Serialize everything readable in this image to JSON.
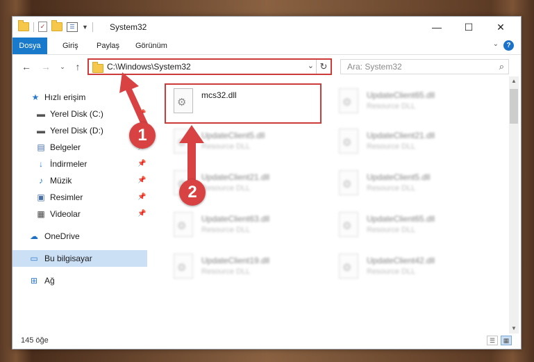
{
  "window": {
    "title": "System32",
    "controls": {
      "minimize": "—",
      "maximize": "☐",
      "close": "✕"
    }
  },
  "menu": {
    "items": [
      "Dosya",
      "Giriş",
      "Paylaş",
      "Görünüm"
    ]
  },
  "address": {
    "path": "C:\\Windows\\System32",
    "search_placeholder": "Ara: System32"
  },
  "sidebar": {
    "items": [
      {
        "label": "Hızlı erişim",
        "icon": "star-icon",
        "pinned": false
      },
      {
        "label": "Yerel Disk (C:)",
        "icon": "drive-icon",
        "pinned": true
      },
      {
        "label": "Yerel Disk (D:)",
        "icon": "drive-icon",
        "pinned": false
      },
      {
        "label": "Belgeler",
        "icon": "documents-icon",
        "pinned": true
      },
      {
        "label": "İndirmeler",
        "icon": "download-icon",
        "pinned": true
      },
      {
        "label": "Müzik",
        "icon": "music-icon",
        "pinned": true
      },
      {
        "label": "Resimler",
        "icon": "pictures-icon",
        "pinned": true
      },
      {
        "label": "Videolar",
        "icon": "video-icon",
        "pinned": true
      },
      {
        "label": "OneDrive",
        "icon": "cloud-icon",
        "pinned": false
      },
      {
        "label": "Bu bilgisayar",
        "icon": "computer-icon",
        "pinned": false,
        "selected": true
      },
      {
        "label": "Ağ",
        "icon": "network-icon",
        "pinned": false
      }
    ]
  },
  "files": [
    {
      "name": "mcs32.dll",
      "type": "",
      "highlighted": true
    },
    {
      "name": "UpdateClient65.dll",
      "type": "Resource DLL"
    },
    {
      "name": "UpdateClient5.dll",
      "type": "Resource DLL"
    },
    {
      "name": "UpdateClient21.dll",
      "type": "Resource DLL"
    },
    {
      "name": "UpdateClient21.dll",
      "type": "Resource DLL"
    },
    {
      "name": "UpdateClient5.dll",
      "type": "Resource DLL"
    },
    {
      "name": "UpdateClient63.dll",
      "type": "Resource DLL"
    },
    {
      "name": "UpdateClient65.dll",
      "type": "Resource DLL"
    },
    {
      "name": "UpdateClient19.dll",
      "type": "Resource DLL"
    },
    {
      "name": "UpdateClient42.dll",
      "type": "Resource DLL"
    }
  ],
  "status": {
    "item_count": "145 öğe"
  },
  "callouts": [
    "1",
    "2"
  ],
  "colors": {
    "accent": "#1979ca",
    "highlight": "#cc3a3a",
    "callout": "#d84242",
    "selection": "#cce0f5"
  }
}
